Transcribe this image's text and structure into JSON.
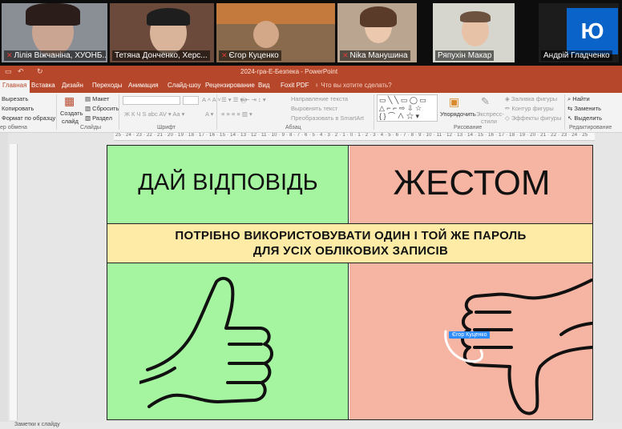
{
  "participants": [
    {
      "name": "Лілія Віжчаніна, ХУОНБ...",
      "muted": true
    },
    {
      "name": "Тетяна Донченко, Херс...",
      "muted": false
    },
    {
      "name": "Єгор Куценко",
      "muted": true
    },
    {
      "name": "Nika Манушина",
      "muted": true
    },
    {
      "name": "Ряпухін Макар",
      "muted": false
    },
    {
      "name": "Андрій Гладченко",
      "muted": false,
      "avatar": "Ю"
    }
  ],
  "window": {
    "title": "2024-гра-Е-Безпека - PowerPoint"
  },
  "tabs": [
    "Главная",
    "Вставка",
    "Дизайн",
    "Переходы",
    "Анимация",
    "Слайд-шоу",
    "Рецензирование",
    "Вид",
    "Foxit PDF"
  ],
  "search_placeholder": "Что вы хотите сделать?",
  "ribbon": {
    "clipboard": {
      "cut": "Вырезать",
      "copy": "Копировать",
      "format": "Формат по образцу",
      "group": "ер обмена"
    },
    "slides": {
      "create": "Создать",
      "create2": "слайд",
      "layout": "Макет",
      "reset": "Сбросить",
      "section": "Раздел",
      "group": "Слайды"
    },
    "font": {
      "group": "Шрифт"
    },
    "paragraph": {
      "direction": "Направление текста",
      "align": "Выровнять текст",
      "smartart": "Преобразовать в SmartArt",
      "group": "Абзац"
    },
    "drawing": {
      "arrange": "Упорядочить",
      "express": "Экспресс-",
      "express2": "стили",
      "fill": "Заливка фигуры",
      "outline": "Контур фигуры",
      "effects": "Эффекты фигуры",
      "group": "Рисование"
    },
    "editing": {
      "find": "Найти",
      "replace": "Заменить",
      "select": "Выделить",
      "group": "Редактирование"
    }
  },
  "ruler_text": "25 · 24 · 23 · 22 · 21 · 20 · 19 · 18 · 17 · 16 · 15 · 14 · 13 · 12 · 11 · 10 · 9 · 8 · 7 · 6 · 5 · 4 · 3 · 2 · 1 · 0 · 1 · 2 · 3 · 4 · 5 · 6 · 7 · 8 · 9 · 10 · 11 · 12 · 13 · 14 · 15 · 16 · 17 · 18 · 19 · 20 · 21 · 22 · 23 · 24 · 25",
  "slide": {
    "left_heading": "ДАЙ ВІДПОВІДЬ",
    "right_heading": "ЖЕСТОМ",
    "statement_line1": "ПОТРІБНО ВИКОРИСТОВУВАТИ ОДИН І ТОЙ ЖЕ ПАРОЛЬ",
    "statement_line2": "ДЛЯ УСІХ ОБЛІКОВИХ ЗАПИСІВ"
  },
  "annotation_cursor": "Єгор Куценко",
  "status_notes": "Заметки к слайду"
}
